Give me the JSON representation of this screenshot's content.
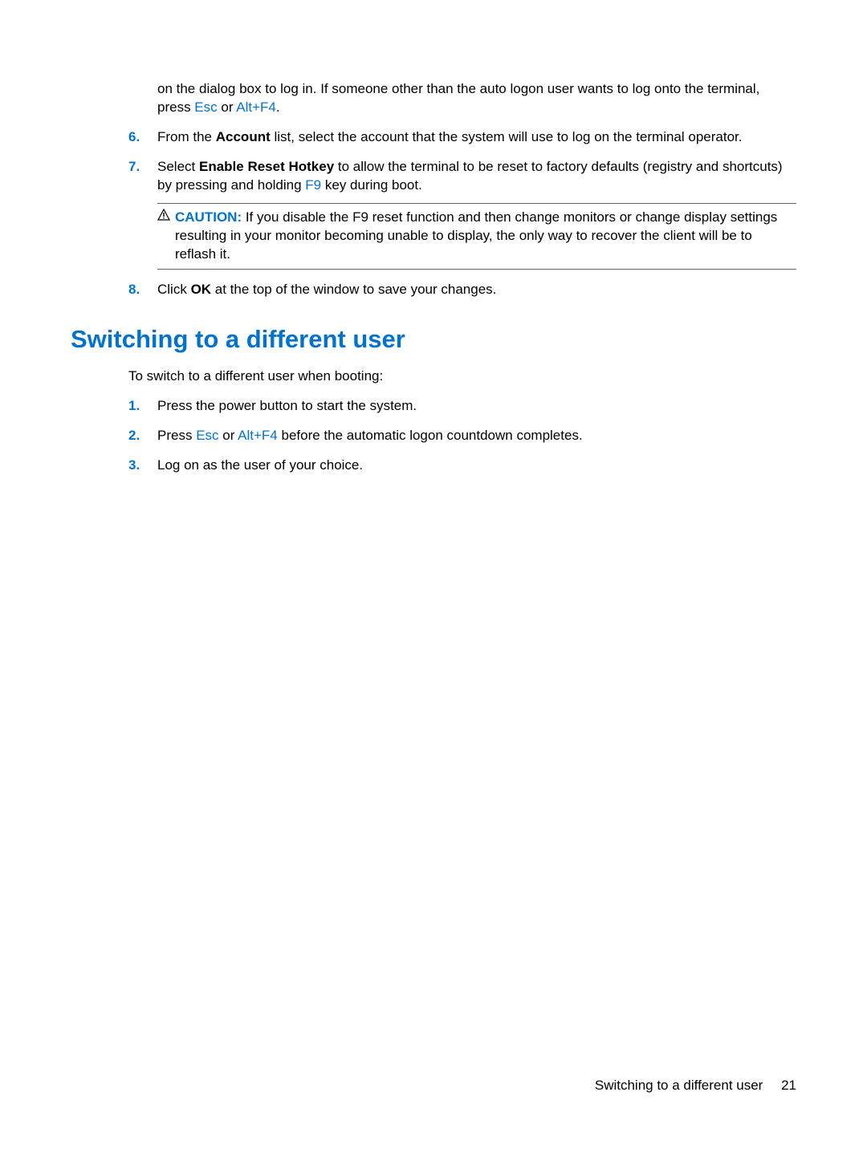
{
  "top_paragraph": {
    "pre": "on the dialog box to log in. If someone other than the auto logon user wants to log onto the terminal, press ",
    "key1": "Esc",
    "mid": " or ",
    "key2": "Alt+F4",
    "post": "."
  },
  "items_upper": [
    {
      "num": "6.",
      "segments": [
        {
          "t": "text",
          "v": "From the "
        },
        {
          "t": "bold",
          "v": "Account"
        },
        {
          "t": "text",
          "v": " list, select the account that the system will use to log on the terminal operator."
        }
      ]
    },
    {
      "num": "7.",
      "segments": [
        {
          "t": "text",
          "v": "Select "
        },
        {
          "t": "bold",
          "v": "Enable Reset Hotkey"
        },
        {
          "t": "text",
          "v": " to allow the terminal to be reset to factory defaults (registry and shortcuts) by pressing and holding "
        },
        {
          "t": "key",
          "v": "F9"
        },
        {
          "t": "text",
          "v": " key during boot."
        }
      ]
    }
  ],
  "caution": {
    "label": "CAUTION:",
    "text": "   If you disable the F9 reset function and then change monitors or change display settings resulting in your monitor becoming unable to display, the only way to recover the client will be to reflash it."
  },
  "item8": {
    "num": "8.",
    "segments": [
      {
        "t": "text",
        "v": "Click "
      },
      {
        "t": "bold",
        "v": "OK"
      },
      {
        "t": "text",
        "v": " at the top of the window to save your changes."
      }
    ]
  },
  "heading": "Switching to a different user",
  "intro_text": "To switch to a different user when booting:",
  "items_lower": [
    {
      "num": "1.",
      "segments": [
        {
          "t": "text",
          "v": "Press the power button to start the system."
        }
      ]
    },
    {
      "num": "2.",
      "segments": [
        {
          "t": "text",
          "v": "Press "
        },
        {
          "t": "key",
          "v": "Esc"
        },
        {
          "t": "text",
          "v": " or "
        },
        {
          "t": "key",
          "v": "Alt+F4"
        },
        {
          "t": "text",
          "v": " before the automatic logon countdown completes."
        }
      ]
    },
    {
      "num": "3.",
      "segments": [
        {
          "t": "text",
          "v": "Log on as the user of your choice."
        }
      ]
    }
  ],
  "footer": {
    "title": "Switching to a different user",
    "page": "21"
  }
}
